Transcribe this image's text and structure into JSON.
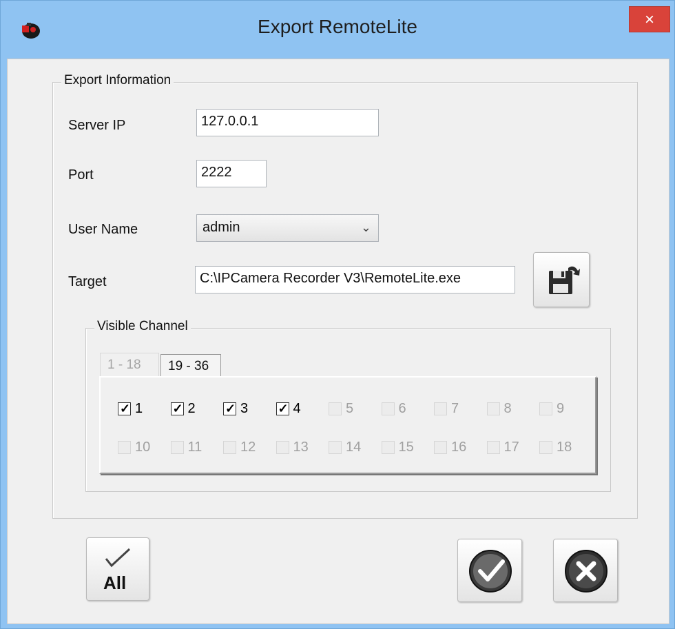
{
  "window": {
    "title": "Export RemoteLite",
    "close_glyph": "×"
  },
  "group": {
    "label": "Export Information"
  },
  "fields": {
    "server_ip_label": "Server IP",
    "server_ip_value": "127.0.0.1",
    "port_label": "Port",
    "port_value": "2222",
    "user_name_label": "User Name",
    "user_name_value": "admin",
    "target_label": "Target",
    "target_value": "C:\\IPCamera Recorder V3\\RemoteLite.exe"
  },
  "visible_channel": {
    "label": "Visible Channel",
    "tabs": [
      {
        "label": "1 - 18",
        "state": "disabled"
      },
      {
        "label": "19 - 36",
        "state": "active"
      }
    ],
    "channels": [
      {
        "label": "1",
        "checked": true,
        "enabled": true
      },
      {
        "label": "2",
        "checked": true,
        "enabled": true
      },
      {
        "label": "3",
        "checked": true,
        "enabled": true
      },
      {
        "label": "4",
        "checked": true,
        "enabled": true
      },
      {
        "label": "5",
        "checked": false,
        "enabled": false
      },
      {
        "label": "6",
        "checked": false,
        "enabled": false
      },
      {
        "label": "7",
        "checked": false,
        "enabled": false
      },
      {
        "label": "8",
        "checked": false,
        "enabled": false
      },
      {
        "label": "9",
        "checked": false,
        "enabled": false
      },
      {
        "label": "10",
        "checked": false,
        "enabled": false
      },
      {
        "label": "11",
        "checked": false,
        "enabled": false
      },
      {
        "label": "12",
        "checked": false,
        "enabled": false
      },
      {
        "label": "13",
        "checked": false,
        "enabled": false
      },
      {
        "label": "14",
        "checked": false,
        "enabled": false
      },
      {
        "label": "15",
        "checked": false,
        "enabled": false
      },
      {
        "label": "16",
        "checked": false,
        "enabled": false
      },
      {
        "label": "17",
        "checked": false,
        "enabled": false
      },
      {
        "label": "18",
        "checked": false,
        "enabled": false
      }
    ]
  },
  "buttons": {
    "select_all_label": "All",
    "save_icon": "save-icon",
    "ok_icon": "ok-check-icon",
    "cancel_icon": "cancel-x-icon"
  },
  "colors": {
    "titlebar": "#8fc3f2",
    "close": "#d9433a",
    "client_bg": "#f0f0f0"
  }
}
